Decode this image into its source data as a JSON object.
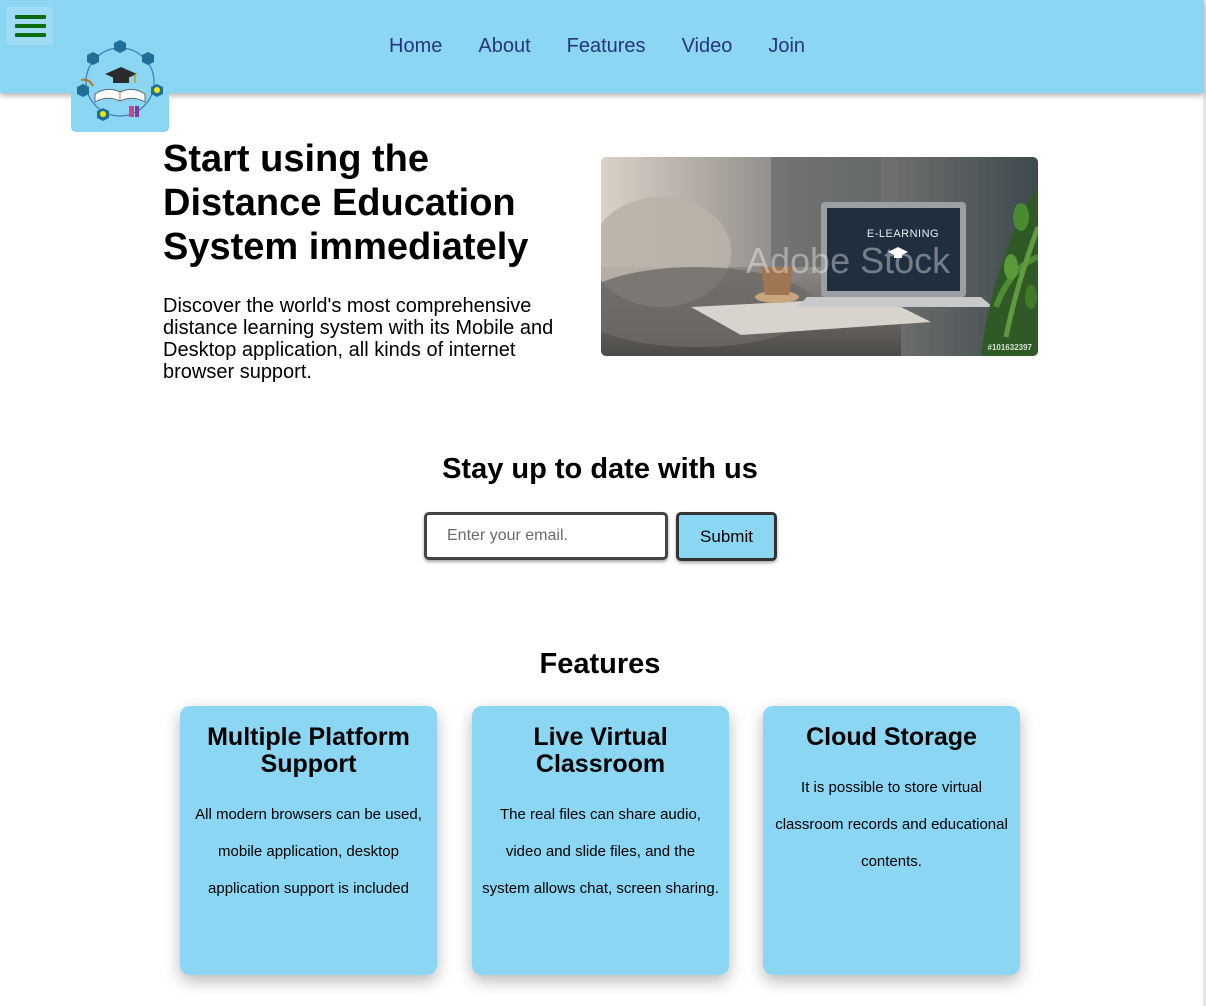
{
  "header": {
    "menu_icon": "hamburger-menu-icon",
    "logo_icon": "education-logo-icon",
    "nav": [
      {
        "label": "Home"
      },
      {
        "label": "About"
      },
      {
        "label": "Features"
      },
      {
        "label": "Video"
      },
      {
        "label": "Join"
      }
    ],
    "colors": {
      "background": "#8ad6f3",
      "nav_text": "#27357a",
      "menu_bars": "#0a6b0e"
    }
  },
  "hero": {
    "title": "Start using the Distance Education System immediately",
    "text": "Discover the world's most comprehensive distance learning system with its Mobile and Desktop application, all kinds of internet browser support.",
    "image": {
      "screen_text": "E-LEARNING",
      "watermark": "Adobe Stock",
      "stock_id": "#101632397"
    }
  },
  "newsletter": {
    "title": "Stay up to date with us",
    "email_placeholder": "Enter your email.",
    "submit_label": "Submit"
  },
  "features": {
    "title": "Features",
    "cards": [
      {
        "title": "Multiple Platform Support",
        "text": "All modern browsers can be used, mobile application, desktop application support is included"
      },
      {
        "title": "Live Virtual Classroom",
        "text": "The real files can share audio, video and slide files, and the system allows chat, screen sharing."
      },
      {
        "title": "Cloud Storage",
        "text": "It is possible to store virtual classroom records and educational contents."
      }
    ],
    "card_color": "#8ad6f3"
  }
}
